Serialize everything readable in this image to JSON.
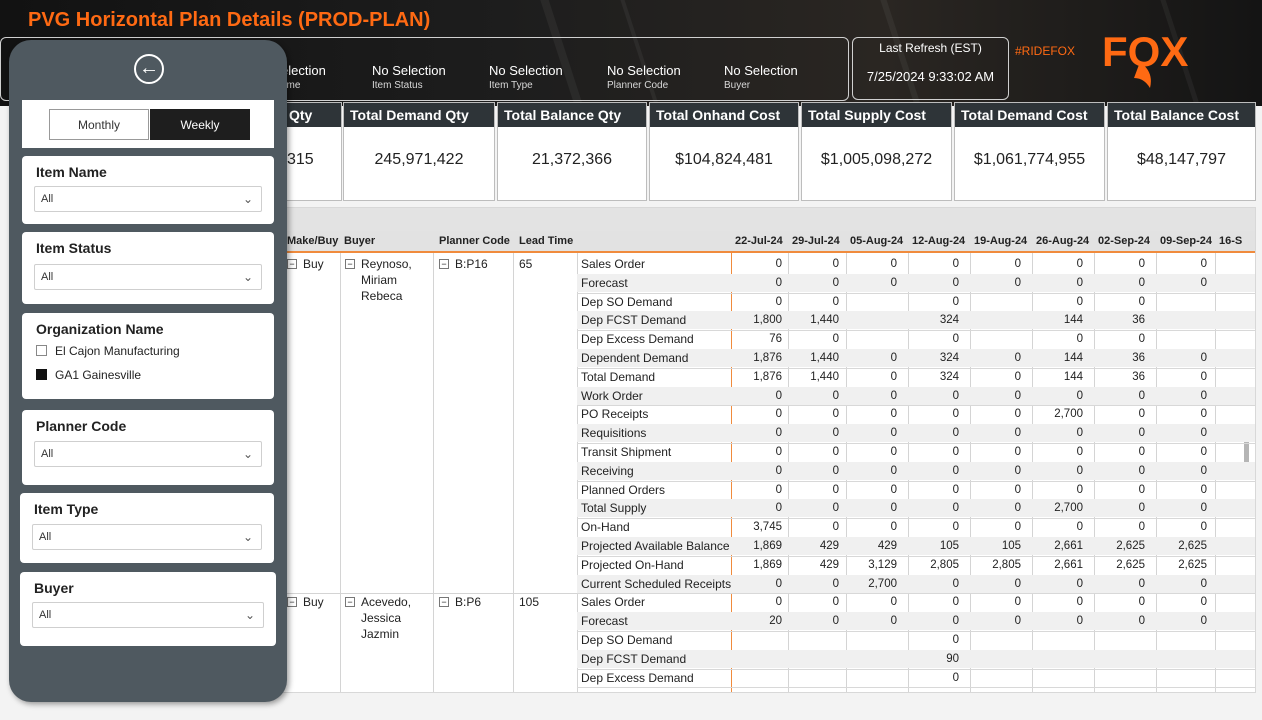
{
  "title": "PVG Horizontal Plan Details (PROD-PLAN)",
  "filters": [
    {
      "value": "election",
      "label": "ame"
    },
    {
      "value": "No Selection",
      "label": "Item Status"
    },
    {
      "value": "No Selection",
      "label": "Item Type"
    },
    {
      "value": "No Selection",
      "label": "Planner Code"
    },
    {
      "value": "No Selection",
      "label": "Buyer"
    }
  ],
  "refresh": {
    "label": "Last Refresh (EST)",
    "value": "7/25/2024 9:33:02 AM"
  },
  "hashtag": "#RIDEFOX",
  "brand": "FOX",
  "kpis": [
    {
      "title": "Qty",
      "value": "315"
    },
    {
      "title": "Total Demand Qty",
      "value": "245,971,422"
    },
    {
      "title": "Total Balance Qty",
      "value": "21,372,366"
    },
    {
      "title": "Total Onhand Cost",
      "value": "$104,824,481"
    },
    {
      "title": "Total Supply Cost",
      "value": "$1,005,098,272"
    },
    {
      "title": "Total Demand Cost",
      "value": "$1,061,774,955"
    },
    {
      "title": "Total Balance Cost",
      "value": "$48,147,797"
    }
  ],
  "matrix": {
    "headers": {
      "makebuy": "Make/Buy",
      "buyer": "Buyer",
      "planner": "Planner Code",
      "lead": "Lead Time"
    },
    "dates": [
      "22-Jul-24",
      "29-Jul-24",
      "05-Aug-24",
      "12-Aug-24",
      "19-Aug-24",
      "26-Aug-24",
      "02-Sep-24",
      "09-Sep-24",
      "16-S"
    ],
    "groups": [
      {
        "makebuy": "Buy",
        "buyer": "Reynoso, Miriam Rebeca",
        "planner": "B:P16",
        "lead": "65"
      },
      {
        "makebuy": "Buy",
        "buyer": "Acevedo, Jessica Jazmin",
        "planner": "B:P6",
        "lead": "105"
      }
    ],
    "rows": [
      {
        "label": "Sales Order",
        "v": [
          "0",
          "0",
          "0",
          "0",
          "0",
          "0",
          "0",
          "0"
        ]
      },
      {
        "label": "Forecast",
        "v": [
          "0",
          "0",
          "0",
          "0",
          "0",
          "0",
          "0",
          "0"
        ]
      },
      {
        "label": "Dep SO Demand",
        "v": [
          "0",
          "0",
          "",
          "0",
          "",
          "0",
          "0",
          ""
        ]
      },
      {
        "label": "Dep FCST Demand",
        "v": [
          "1,800",
          "1,440",
          "",
          "324",
          "",
          "144",
          "36",
          ""
        ]
      },
      {
        "label": "Dep Excess Demand",
        "v": [
          "76",
          "0",
          "",
          "0",
          "",
          "0",
          "0",
          ""
        ]
      },
      {
        "label": "Dependent Demand",
        "v": [
          "1,876",
          "1,440",
          "0",
          "324",
          "0",
          "144",
          "36",
          "0"
        ]
      },
      {
        "label": "Total Demand",
        "v": [
          "1,876",
          "1,440",
          "0",
          "324",
          "0",
          "144",
          "36",
          "0"
        ]
      },
      {
        "label": "Work Order",
        "v": [
          "0",
          "0",
          "0",
          "0",
          "0",
          "0",
          "0",
          "0"
        ]
      },
      {
        "label": "PO Receipts",
        "v": [
          "0",
          "0",
          "0",
          "0",
          "0",
          "2,700",
          "0",
          "0"
        ]
      },
      {
        "label": "Requisitions",
        "v": [
          "0",
          "0",
          "0",
          "0",
          "0",
          "0",
          "0",
          "0"
        ]
      },
      {
        "label": "Transit Shipment",
        "v": [
          "0",
          "0",
          "0",
          "0",
          "0",
          "0",
          "0",
          "0"
        ]
      },
      {
        "label": "Receiving",
        "v": [
          "0",
          "0",
          "0",
          "0",
          "0",
          "0",
          "0",
          "0"
        ]
      },
      {
        "label": "Planned Orders",
        "v": [
          "0",
          "0",
          "0",
          "0",
          "0",
          "0",
          "0",
          "0"
        ]
      },
      {
        "label": "Total Supply",
        "v": [
          "0",
          "0",
          "0",
          "0",
          "0",
          "2,700",
          "0",
          "0"
        ]
      },
      {
        "label": "On-Hand",
        "v": [
          "3,745",
          "0",
          "0",
          "0",
          "0",
          "0",
          "0",
          "0"
        ]
      },
      {
        "label": "Projected Available Balance",
        "v": [
          "1,869",
          "429",
          "429",
          "105",
          "105",
          "2,661",
          "2,625",
          "2,625"
        ]
      },
      {
        "label": "Projected On-Hand",
        "v": [
          "1,869",
          "429",
          "3,129",
          "2,805",
          "2,805",
          "2,661",
          "2,625",
          "2,625"
        ]
      },
      {
        "label": "Current Scheduled Receipts",
        "v": [
          "0",
          "0",
          "2,700",
          "0",
          "0",
          "0",
          "0",
          "0"
        ]
      },
      {
        "label": "Sales Order",
        "v": [
          "0",
          "0",
          "0",
          "0",
          "0",
          "0",
          "0",
          "0"
        ]
      },
      {
        "label": "Forecast",
        "v": [
          "20",
          "0",
          "0",
          "0",
          "0",
          "0",
          "0",
          "0"
        ]
      },
      {
        "label": "Dep SO Demand",
        "v": [
          "",
          "",
          "",
          "0",
          "",
          "",
          "",
          ""
        ]
      },
      {
        "label": "Dep FCST Demand",
        "v": [
          "",
          "",
          "",
          "90",
          "",
          "",
          "",
          ""
        ]
      },
      {
        "label": "Dep Excess Demand",
        "v": [
          "",
          "",
          "",
          "0",
          "",
          "",
          "",
          ""
        ]
      }
    ]
  },
  "panel": {
    "toggle": {
      "monthly": "Monthly",
      "weekly": "Weekly"
    },
    "item_name": {
      "title": "Item Name",
      "value": "All"
    },
    "item_status": {
      "title": "Item Status",
      "value": "All"
    },
    "org": {
      "title": "Organization Name",
      "options": [
        "El Cajon Manufacturing",
        "GA1 Gainesville"
      ]
    },
    "planner": {
      "title": "Planner Code",
      "value": "All"
    },
    "item_type": {
      "title": "Item Type",
      "value": "All"
    },
    "buyer": {
      "title": "Buyer",
      "value": "All"
    }
  }
}
